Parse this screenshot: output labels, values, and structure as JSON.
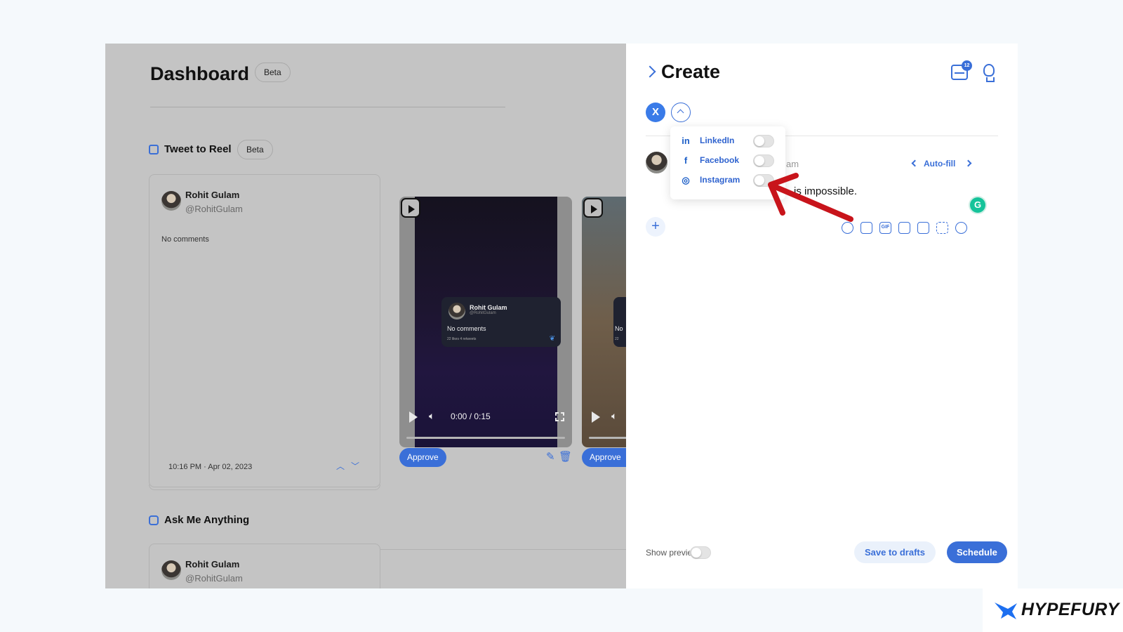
{
  "dashboard": {
    "title": "Dashboard",
    "title_badge": "Beta",
    "section_tweet_to_reel": {
      "title": "Tweet to Reel",
      "badge": "Beta"
    },
    "section_ama": {
      "title": "Ask Me Anything"
    },
    "tweet_card": {
      "name": "Rohit Gulam",
      "handle": "@RohitGulam",
      "comments": "No comments",
      "timestamp": "10:16 PM · Apr 02, 2023"
    },
    "reel": {
      "mini_name": "Rohit Gulam",
      "mini_handle": "@RohitGulam",
      "mini_comments": "No comments",
      "mini_stats": "22 likes  4 retweets",
      "time": "0:00 / 0:15",
      "approve_label": "Approve",
      "reel2_approve_label": "Approve",
      "reel2_partial_text": "No",
      "reel2_partial_stats": "22"
    },
    "ama_card": {
      "name": "Rohit Gulam",
      "handle": "@RohitGulam"
    }
  },
  "create": {
    "title": "Create",
    "queue_badge": "12",
    "network_button": "X",
    "handle_tail": "am",
    "autofill_label": "Auto-fill",
    "tweet_text": "is impossible.",
    "grammarly_label": "G",
    "add_label": "+",
    "show_preview_label": "Show preview",
    "save_drafts_label": "Save to drafts",
    "schedule_label": "Schedule",
    "toolbar_gif_label": "GIF"
  },
  "network_dropdown": {
    "items": [
      {
        "label": "LinkedIn",
        "icon": "linkedin-icon",
        "glyph": "in",
        "enabled": false
      },
      {
        "label": "Facebook",
        "icon": "facebook-icon",
        "glyph": "f",
        "enabled": false
      },
      {
        "label": "Instagram",
        "icon": "instagram-icon",
        "glyph": "◎",
        "enabled": false
      }
    ]
  },
  "brand": {
    "name": "HYPEFURY"
  },
  "colors": {
    "accent": "#3a6fd8",
    "annotation_arrow": "#c8141b",
    "overlay": "#c4c4c4"
  }
}
